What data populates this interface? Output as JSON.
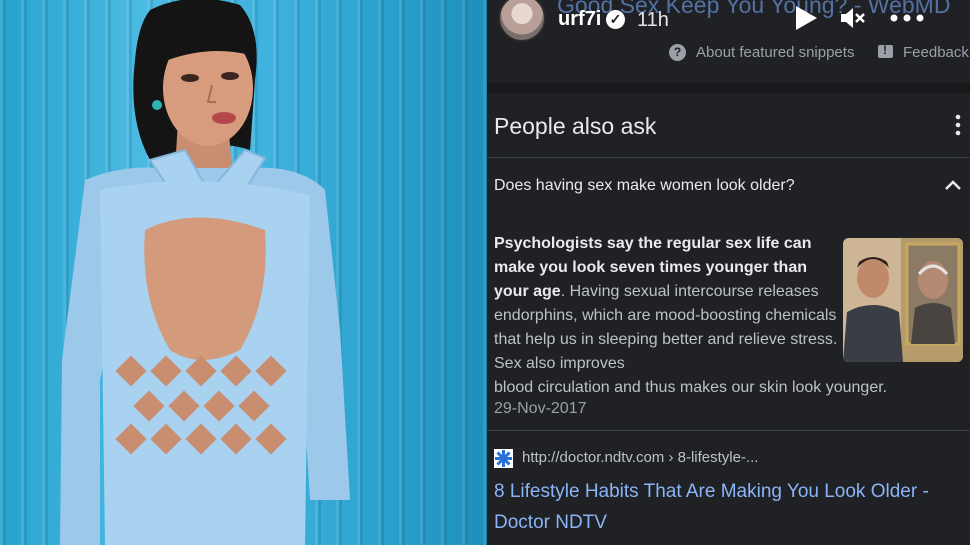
{
  "story": {
    "background_title": "Good Sex Keep You Young? - WebMD",
    "username": "urf7i",
    "verified_mark": "✓",
    "time_ago": "11h"
  },
  "snippet_bar": {
    "help_glyph": "?",
    "about_label": "About featured snippets",
    "feedback_label": "Feedback"
  },
  "paa": {
    "title": "People also ask",
    "question": "Does having sex make women look older?",
    "answer_bold": "Psychologists say the regular sex life can make you look seven times younger than your age",
    "answer_text": ". Having sexual intercourse releases endorphins, which are mood-boosting chemicals that help us in sleeping better and relieve stress. Sex also improves",
    "answer_rest": "blood circulation and thus makes our skin look younger.",
    "date": "29-Nov-2017"
  },
  "result": {
    "url": "http://doctor.ndtv.com › 8-lifestyle-...",
    "title": "8 Lifestyle Habits That Are Making You Look Older - Doctor NDTV"
  },
  "colors": {
    "background": "#202124",
    "link_blue": "#8ab4f8",
    "photo_wall": "#3fb2dd",
    "dress": "#a9d1f0"
  }
}
